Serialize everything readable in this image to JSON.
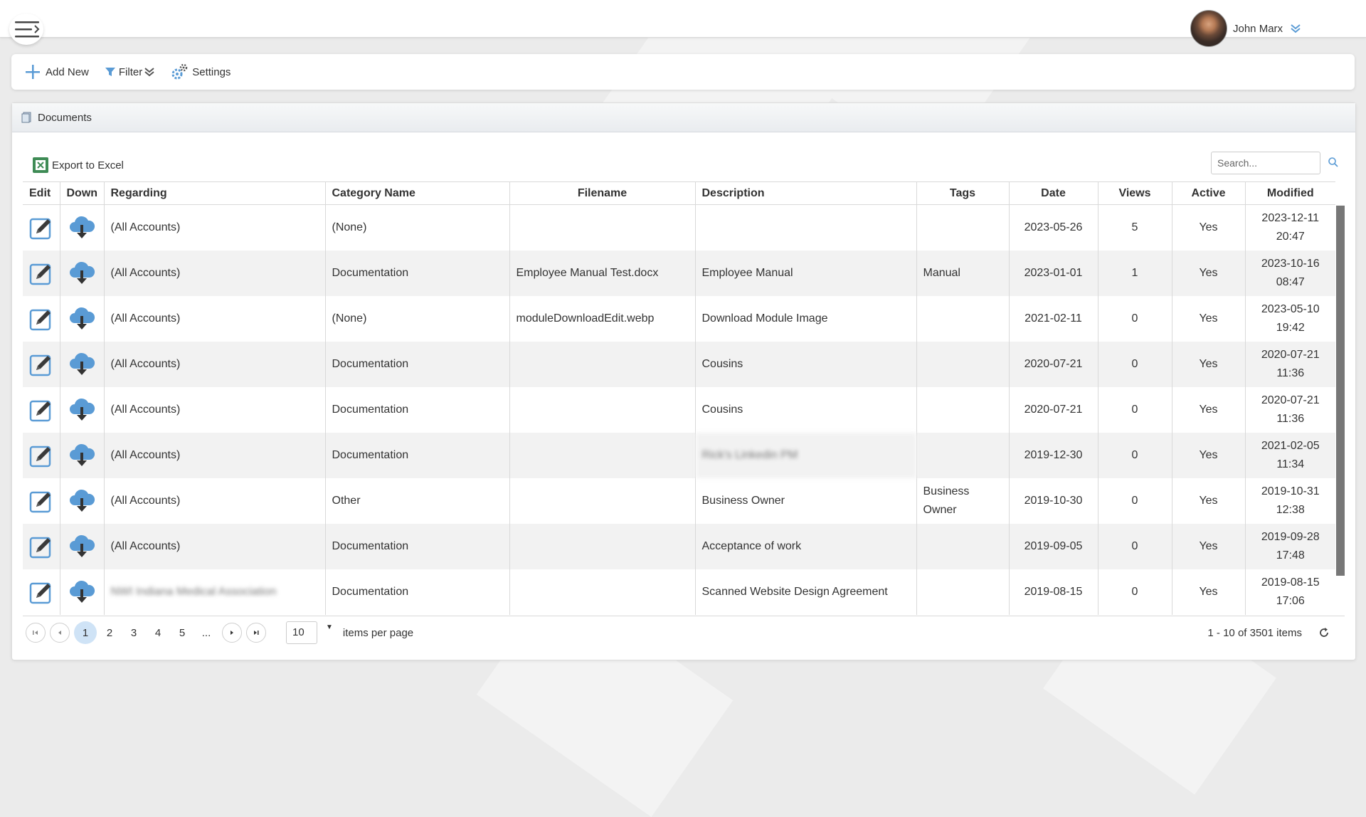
{
  "header": {
    "user_name": "John Marx",
    "icons": [
      "hamburger-menu-icon",
      "avatar",
      "chevron-down-icon"
    ]
  },
  "toolbar": {
    "add_new_label": "Add New",
    "filter_label": "Filter",
    "settings_label": "Settings"
  },
  "panel": {
    "title": "Documents",
    "export_label": "Export to Excel",
    "search_placeholder": "Search..."
  },
  "table": {
    "columns": [
      "Edit",
      "Down",
      "Regarding",
      "Category Name",
      "Filename",
      "Description",
      "Tags",
      "Date",
      "Views",
      "Active",
      "Modified"
    ],
    "rows": [
      {
        "regarding": "(All Accounts)",
        "category": "(None)",
        "filename": "",
        "description": "",
        "tags": "",
        "date": "2023-05-26",
        "views": "5",
        "active": "Yes",
        "modified_date": "2023-12-11",
        "modified_time": "20:47"
      },
      {
        "regarding": "(All Accounts)",
        "category": "Documentation",
        "filename": "Employee Manual Test.docx",
        "description": "Employee Manual",
        "tags": "Manual",
        "date": "2023-01-01",
        "views": "1",
        "active": "Yes",
        "modified_date": "2023-10-16",
        "modified_time": "08:47"
      },
      {
        "regarding": "(All Accounts)",
        "category": "(None)",
        "filename": "moduleDownloadEdit.webp",
        "description": "Download Module Image",
        "tags": "",
        "date": "2021-02-11",
        "views": "0",
        "active": "Yes",
        "modified_date": "2023-05-10",
        "modified_time": "19:42"
      },
      {
        "regarding": "(All Accounts)",
        "category": "Documentation",
        "filename": "",
        "description": "Cousins",
        "tags": "",
        "date": "2020-07-21",
        "views": "0",
        "active": "Yes",
        "modified_date": "2020-07-21",
        "modified_time": "11:36"
      },
      {
        "regarding": "(All Accounts)",
        "category": "Documentation",
        "filename": "",
        "description": "Cousins",
        "tags": "",
        "date": "2020-07-21",
        "views": "0",
        "active": "Yes",
        "modified_date": "2020-07-21",
        "modified_time": "11:36"
      },
      {
        "regarding": "(All Accounts)",
        "category": "Documentation",
        "filename": "",
        "description": "Rick's Linkedin PM",
        "tags": "",
        "date": "2019-12-30",
        "views": "0",
        "active": "Yes",
        "modified_date": "2021-02-05",
        "modified_time": "11:34"
      },
      {
        "regarding": "(All Accounts)",
        "category": "Other",
        "filename": "",
        "description": "Business Owner",
        "tags": "Business Owner",
        "date": "2019-10-30",
        "views": "0",
        "active": "Yes",
        "modified_date": "2019-10-31",
        "modified_time": "12:38"
      },
      {
        "regarding": "(All Accounts)",
        "category": "Documentation",
        "filename": "",
        "description": "Acceptance of work",
        "tags": "",
        "date": "2019-09-05",
        "views": "0",
        "active": "Yes",
        "modified_date": "2019-09-28",
        "modified_time": "17:48"
      },
      {
        "regarding": "NWI Indiana Medical Association",
        "category": "Documentation",
        "filename": "",
        "description": "Scanned Website Design Agreement",
        "tags": "",
        "date": "2019-08-15",
        "views": "0",
        "active": "Yes",
        "modified_date": "2019-08-15",
        "modified_time": "17:06"
      }
    ]
  },
  "pager": {
    "pages": [
      "1",
      "2",
      "3",
      "4",
      "5",
      "..."
    ],
    "active_page": "1",
    "per_page": "10",
    "per_page_label": "items per page",
    "items_info": "1 - 10 of 3501 items"
  },
  "colors": {
    "accent": "#5a9bd5",
    "active_page_bg": "#cfe3f6",
    "row_alt": "#f2f2f2",
    "excel_green": "#3e8b55"
  }
}
